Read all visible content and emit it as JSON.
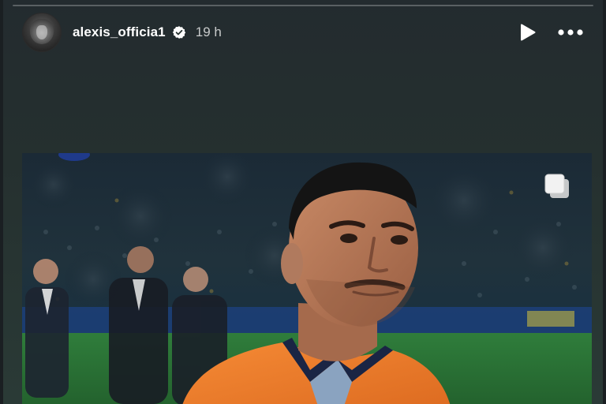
{
  "story": {
    "username": "alexis_officia1",
    "verified": true,
    "timestamp": "19 h",
    "controls": {
      "play_icon": "play-icon",
      "more_icon": "more-options-icon"
    }
  },
  "post": {
    "image_description_icon": "multiple-images-icon"
  },
  "colors": {
    "background": "#25302f",
    "jersey": "#f07a2a",
    "pitch": "#2f7a3a"
  }
}
